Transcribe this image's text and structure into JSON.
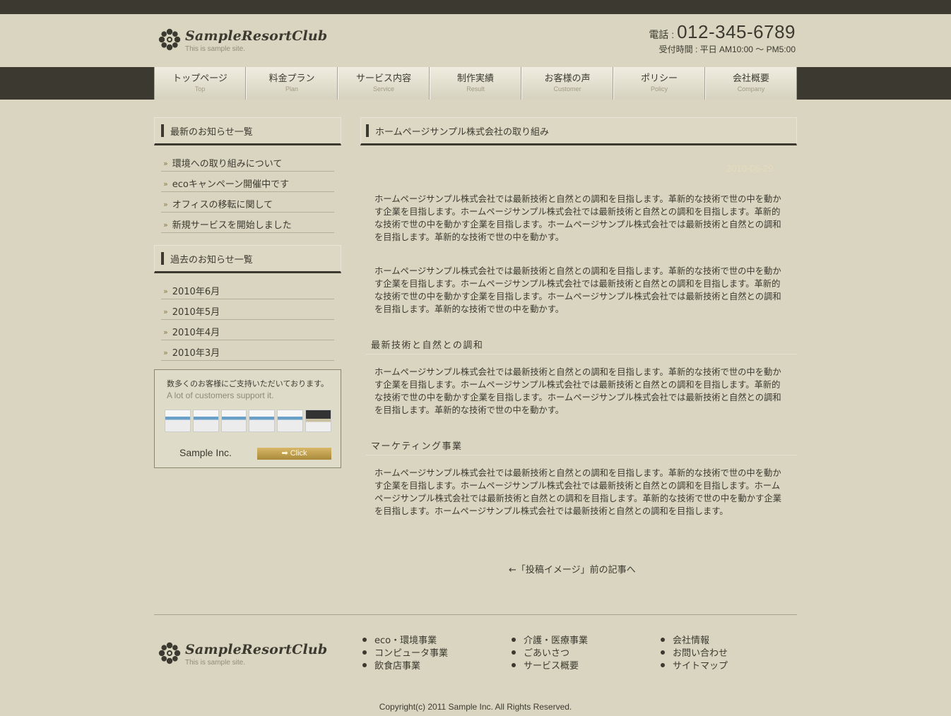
{
  "header": {
    "logo_name": "SampleResortClub",
    "logo_tagline": "This is sample site.",
    "phone_label": "電話 : ",
    "phone_number": "012-345-6789",
    "hours": "受付時間 : 平日 AM10:00 ～ PM5:00"
  },
  "nav": {
    "items": [
      {
        "label": "トップページ",
        "sub": "Top"
      },
      {
        "label": "料金プラン",
        "sub": "Plan"
      },
      {
        "label": "サービス内容",
        "sub": "Service"
      },
      {
        "label": "制作実績",
        "sub": "Result"
      },
      {
        "label": "お客様の声",
        "sub": "Customer"
      },
      {
        "label": "ポリシー",
        "sub": "Policy"
      },
      {
        "label": "会社概要",
        "sub": "Company"
      }
    ]
  },
  "sidebar": {
    "recent_title": "最新のお知らせ一覧",
    "recent_items": [
      "環境への取り組みについて",
      "ecoキャンペーン開催中です",
      "オフィスの移転に関して",
      "新規サービスを開始しました"
    ],
    "past_title": "過去のお知らせ一覧",
    "past_items": [
      "2010年6月",
      "2010年5月",
      "2010年4月",
      "2010年3月"
    ],
    "arrow": "»",
    "banner": {
      "line1": "数多くのお客様にご支持いただいております。",
      "line2": "A lot of customers support it.",
      "company": "Sample Inc.",
      "button": "➡ Click"
    }
  },
  "main": {
    "title": "ホームページサンプル株式会社の取り組み",
    "date": "2010-06-29",
    "para1": "ホームページサンプル株式会社では最新技術と自然との調和を目指します。革新的な技術で世の中を動かす企業を目指します。ホームページサンプル株式会社では最新技術と自然との調和を目指します。革新的な技術で世の中を動かす企業を目指します。ホームページサンプル株式会社では最新技術と自然との調和を目指します。革新的な技術で世の中を動かす。",
    "para2": "ホームページサンプル株式会社では最新技術と自然との調和を目指します。革新的な技術で世の中を動かす企業を目指します。ホームページサンプル株式会社では最新技術と自然との調和を目指します。革新的な技術で世の中を動かす企業を目指します。ホームページサンプル株式会社では最新技術と自然との調和を目指します。革新的な技術で世の中を動かす。",
    "sub1": "最新技術と自然との調和",
    "para3": "ホームページサンプル株式会社では最新技術と自然との調和を目指します。革新的な技術で世の中を動かす企業を目指します。ホームページサンプル株式会社では最新技術と自然との調和を目指します。革新的な技術で世の中を動かす企業を目指します。ホームページサンプル株式会社では最新技術と自然との調和を目指します。革新的な技術で世の中を動かす。",
    "sub2": "マーケティング事業",
    "para4": "ホームページサンプル株式会社では最新技術と自然との調和を目指します。革新的な技術で世の中を動かす企業を目指します。ホームページサンプル株式会社では最新技術と自然との調和を目指します。ホームページサンプル株式会社では最新技術と自然との調和を目指します。革新的な技術で世の中を動かす企業を目指します。ホームページサンプル株式会社では最新技術と自然との調和を目指します。",
    "prev_link": "←「投稿イメージ」前の記事へ"
  },
  "footer": {
    "col1": [
      "eco・環境事業",
      "コンピュータ事業",
      "飲食店事業"
    ],
    "col2": [
      "介護・医療事業",
      "ごあいさつ",
      "サービス概要"
    ],
    "col3": [
      "会社情報",
      "お問い合わせ",
      "サイトマップ"
    ],
    "copyright": "Copyright(c) 2011 Sample Inc. All Rights Reserved."
  },
  "colors": {
    "background": "#d9d5c0",
    "dark": "#3c3a30",
    "gold": "#c8a855"
  }
}
